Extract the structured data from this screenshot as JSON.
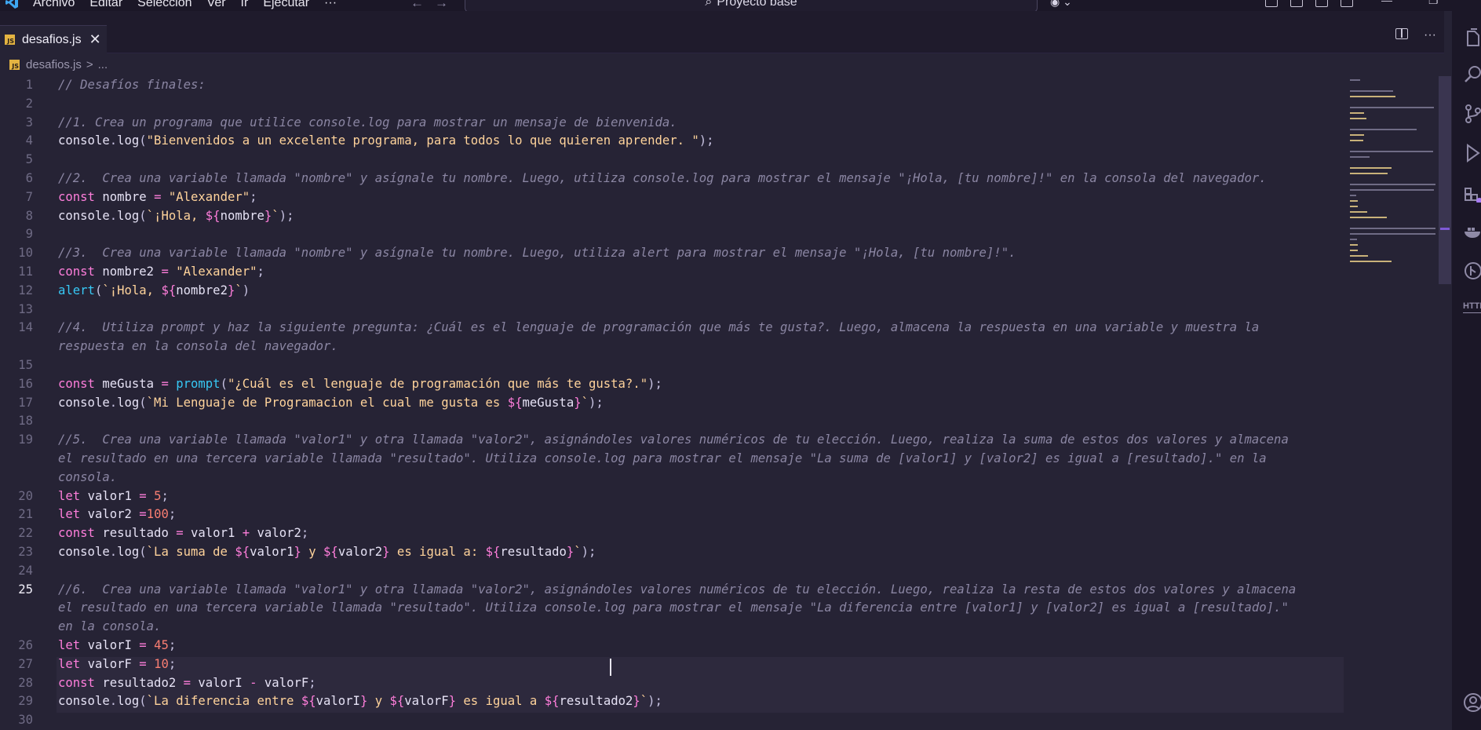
{
  "menu": [
    "Archivo",
    "Editar",
    "Selección",
    "Ver",
    "Ir",
    "Ejecutar",
    "···"
  ],
  "command_center": {
    "text": "Proyecto base"
  },
  "tab": {
    "label": "desafios.js",
    "icon": "JS"
  },
  "breadcrumb": {
    "file": "desafios.js",
    "separator": ">",
    "more": "..."
  },
  "editor": {
    "active_line": "25"
  },
  "lines": [
    {
      "n": "1",
      "tokens": [
        {
          "c": "comment",
          "t": "// Desafíos finales:"
        }
      ]
    },
    {
      "n": "2",
      "tokens": []
    },
    {
      "n": "3",
      "tokens": [
        {
          "c": "comment",
          "t": "//1. Crea un programa que utilice console.log para mostrar un mensaje de bienvenida."
        }
      ]
    },
    {
      "n": "4",
      "tokens": [
        {
          "c": "t",
          "t": "console"
        },
        {
          "c": "p",
          "t": "."
        },
        {
          "c": "t",
          "t": "log"
        },
        {
          "c": "p",
          "t": "("
        },
        {
          "c": "s",
          "t": "\"Bienvenidos a un excelente programa, para todos lo que quieren aprender. \""
        },
        {
          "c": "p",
          "t": ");"
        }
      ]
    },
    {
      "n": "5",
      "tokens": []
    },
    {
      "n": "6",
      "tokens": [
        {
          "c": "comment",
          "t": "//2.  Crea una variable llamada \"nombre\" y asígnale tu nombre. Luego, utiliza console.log para mostrar el mensaje \"¡Hola, [tu nombre]!\" en la consola del navegador."
        }
      ]
    },
    {
      "n": "7",
      "tokens": [
        {
          "c": "k",
          "t": "const "
        },
        {
          "c": "t",
          "t": "nombre"
        },
        {
          "c": "k",
          "t": " = "
        },
        {
          "c": "s",
          "t": "\"Alexander\""
        },
        {
          "c": "p",
          "t": ";"
        }
      ]
    },
    {
      "n": "8",
      "tokens": [
        {
          "c": "t",
          "t": "console"
        },
        {
          "c": "p",
          "t": "."
        },
        {
          "c": "t",
          "t": "log"
        },
        {
          "c": "p",
          "t": "("
        },
        {
          "c": "s",
          "t": "`¡Hola, "
        },
        {
          "c": "i",
          "t": "${"
        },
        {
          "c": "t",
          "t": "nombre"
        },
        {
          "c": "i",
          "t": "}"
        },
        {
          "c": "s",
          "t": "`"
        },
        {
          "c": "p",
          "t": ");"
        }
      ]
    },
    {
      "n": "9",
      "tokens": []
    },
    {
      "n": "10",
      "tokens": [
        {
          "c": "comment",
          "t": "//3.  Crea una variable llamada \"nombre\" y asígnale tu nombre. Luego, utiliza alert para mostrar el mensaje \"¡Hola, [tu nombre]!\"."
        }
      ]
    },
    {
      "n": "11",
      "tokens": [
        {
          "c": "k",
          "t": "const "
        },
        {
          "c": "t",
          "t": "nombre2"
        },
        {
          "c": "k",
          "t": " = "
        },
        {
          "c": "s",
          "t": "\"Alexander\""
        },
        {
          "c": "p",
          "t": ";"
        }
      ]
    },
    {
      "n": "12",
      "tokens": [
        {
          "c": "f",
          "t": "alert"
        },
        {
          "c": "p",
          "t": "("
        },
        {
          "c": "s",
          "t": "`¡Hola, "
        },
        {
          "c": "i",
          "t": "${"
        },
        {
          "c": "t",
          "t": "nombre2"
        },
        {
          "c": "i",
          "t": "}"
        },
        {
          "c": "s",
          "t": "`"
        },
        {
          "c": "p",
          "t": ")"
        }
      ]
    },
    {
      "n": "13",
      "tokens": []
    },
    {
      "n": "14",
      "tokens": [
        {
          "c": "comment",
          "t": "//4.  Utiliza prompt y haz la siguiente pregunta: ¿Cuál es el lenguaje de programación que más te gusta?. Luego, almacena la respuesta en una variable y muestra la"
        }
      ]
    },
    {
      "n": "",
      "tokens": [
        {
          "c": "comment",
          "t": "respuesta en la consola del navegador."
        }
      ]
    },
    {
      "n": "15",
      "tokens": []
    },
    {
      "n": "16",
      "tokens": [
        {
          "c": "k",
          "t": "const "
        },
        {
          "c": "t",
          "t": "meGusta"
        },
        {
          "c": "k",
          "t": " = "
        },
        {
          "c": "f",
          "t": "prompt"
        },
        {
          "c": "p",
          "t": "("
        },
        {
          "c": "s",
          "t": "\"¿Cuál es el lenguaje de programación que más te gusta?.\""
        },
        {
          "c": "p",
          "t": ");"
        }
      ]
    },
    {
      "n": "17",
      "tokens": [
        {
          "c": "t",
          "t": "console"
        },
        {
          "c": "p",
          "t": "."
        },
        {
          "c": "t",
          "t": "log"
        },
        {
          "c": "p",
          "t": "("
        },
        {
          "c": "s",
          "t": "`Mi Lenguaje de Programacion el cual me gusta es "
        },
        {
          "c": "i",
          "t": "${"
        },
        {
          "c": "t",
          "t": "meGusta"
        },
        {
          "c": "i",
          "t": "}"
        },
        {
          "c": "s",
          "t": "`"
        },
        {
          "c": "p",
          "t": ");"
        }
      ]
    },
    {
      "n": "18",
      "tokens": []
    },
    {
      "n": "19",
      "tokens": [
        {
          "c": "comment",
          "t": "//5.  Crea una variable llamada \"valor1\" y otra llamada \"valor2\", asignándoles valores numéricos de tu elección. Luego, realiza la suma de estos dos valores y almacena"
        }
      ]
    },
    {
      "n": "",
      "tokens": [
        {
          "c": "comment",
          "t": "el resultado en una tercera variable llamada \"resultado\". Utiliza console.log para mostrar el mensaje \"La suma de [valor1] y [valor2] es igual a [resultado].\" en la"
        }
      ]
    },
    {
      "n": "",
      "tokens": [
        {
          "c": "comment",
          "t": "consola."
        }
      ]
    },
    {
      "n": "20",
      "tokens": [
        {
          "c": "k",
          "t": "let "
        },
        {
          "c": "t",
          "t": "valor1"
        },
        {
          "c": "k",
          "t": " = "
        },
        {
          "c": "n",
          "t": "5"
        },
        {
          "c": "p",
          "t": ";"
        }
      ]
    },
    {
      "n": "21",
      "tokens": [
        {
          "c": "k",
          "t": "let "
        },
        {
          "c": "t",
          "t": "valor2"
        },
        {
          "c": "k",
          "t": " ="
        },
        {
          "c": "n",
          "t": "100"
        },
        {
          "c": "p",
          "t": ";"
        }
      ]
    },
    {
      "n": "22",
      "tokens": [
        {
          "c": "k",
          "t": "const "
        },
        {
          "c": "t",
          "t": "resultado"
        },
        {
          "c": "k",
          "t": " = "
        },
        {
          "c": "t",
          "t": "valor1"
        },
        {
          "c": "k",
          "t": " + "
        },
        {
          "c": "t",
          "t": "valor2"
        },
        {
          "c": "p",
          "t": ";"
        }
      ]
    },
    {
      "n": "23",
      "tokens": [
        {
          "c": "t",
          "t": "console"
        },
        {
          "c": "p",
          "t": "."
        },
        {
          "c": "t",
          "t": "log"
        },
        {
          "c": "p",
          "t": "("
        },
        {
          "c": "s",
          "t": "`La suma de "
        },
        {
          "c": "i",
          "t": "${"
        },
        {
          "c": "t",
          "t": "valor1"
        },
        {
          "c": "i",
          "t": "}"
        },
        {
          "c": "s",
          "t": " y "
        },
        {
          "c": "i",
          "t": "${"
        },
        {
          "c": "t",
          "t": "valor2"
        },
        {
          "c": "i",
          "t": "}"
        },
        {
          "c": "s",
          "t": " es igual a: "
        },
        {
          "c": "i",
          "t": "${"
        },
        {
          "c": "t",
          "t": "resultado"
        },
        {
          "c": "i",
          "t": "}"
        },
        {
          "c": "s",
          "t": "`"
        },
        {
          "c": "p",
          "t": ");"
        }
      ]
    },
    {
      "n": "24",
      "tokens": []
    },
    {
      "n": "25",
      "tokens": [
        {
          "c": "comment",
          "t": "//6.  Crea una variable llamada \"valor1\" y otra llamada \"valor2\", asignándoles valores numéricos de tu elección. Luego, realiza la resta de estos dos valores y almacena"
        }
      ]
    },
    {
      "n": "",
      "tokens": [
        {
          "c": "comment",
          "t": "el resultado en una tercera variable llamada \"resultado\". Utiliza console.log para mostrar el mensaje \"La diferencia entre [valor1] y [valor2] es igual a [resultado].\""
        }
      ]
    },
    {
      "n": "",
      "tokens": [
        {
          "c": "comment",
          "t": "en la consola."
        }
      ]
    },
    {
      "n": "26",
      "tokens": [
        {
          "c": "k",
          "t": "let "
        },
        {
          "c": "t",
          "t": "valorI"
        },
        {
          "c": "k",
          "t": " = "
        },
        {
          "c": "n",
          "t": "45"
        },
        {
          "c": "p",
          "t": ";"
        }
      ]
    },
    {
      "n": "27",
      "tokens": [
        {
          "c": "k",
          "t": "let "
        },
        {
          "c": "t",
          "t": "valorF"
        },
        {
          "c": "k",
          "t": " = "
        },
        {
          "c": "n",
          "t": "10"
        },
        {
          "c": "p",
          "t": ";"
        }
      ]
    },
    {
      "n": "28",
      "tokens": [
        {
          "c": "k",
          "t": "const "
        },
        {
          "c": "t",
          "t": "resultado2"
        },
        {
          "c": "k",
          "t": " = "
        },
        {
          "c": "t",
          "t": "valorI"
        },
        {
          "c": "k",
          "t": " - "
        },
        {
          "c": "t",
          "t": "valorF"
        },
        {
          "c": "p",
          "t": ";"
        }
      ]
    },
    {
      "n": "29",
      "tokens": [
        {
          "c": "t",
          "t": "console"
        },
        {
          "c": "p",
          "t": "."
        },
        {
          "c": "t",
          "t": "log"
        },
        {
          "c": "p",
          "t": "("
        },
        {
          "c": "s",
          "t": "`La diferencia entre "
        },
        {
          "c": "i",
          "t": "${"
        },
        {
          "c": "t",
          "t": "valorI"
        },
        {
          "c": "i",
          "t": "}"
        },
        {
          "c": "s",
          "t": " y "
        },
        {
          "c": "i",
          "t": "${"
        },
        {
          "c": "t",
          "t": "valorF"
        },
        {
          "c": "i",
          "t": "}"
        },
        {
          "c": "s",
          "t": " es igual a "
        },
        {
          "c": "i",
          "t": "${"
        },
        {
          "c": "t",
          "t": "resultado2"
        },
        {
          "c": "i",
          "t": "}"
        },
        {
          "c": "s",
          "t": "`"
        },
        {
          "c": "p",
          "t": ");"
        }
      ]
    },
    {
      "n": "30",
      "tokens": []
    }
  ],
  "colors": {
    "background": "#262335",
    "comment": "#8b86a3",
    "keyword": "#fe7edb",
    "string": "#ffd39b",
    "number": "#f97e72",
    "function": "#37c8f5"
  },
  "icons": [
    "vscode-logo-icon",
    "arrow-left-icon",
    "arrow-right-icon",
    "search-icon",
    "copilot-icon",
    "layout-icon",
    "minimize-icon",
    "restore-icon",
    "split-editor-icon",
    "more-icon",
    "files-icon",
    "search-icon",
    "source-control-icon",
    "run-debug-icon",
    "extensions-icon",
    "docker-icon",
    "git-graph-icon",
    "http-icon",
    "account-icon"
  ]
}
